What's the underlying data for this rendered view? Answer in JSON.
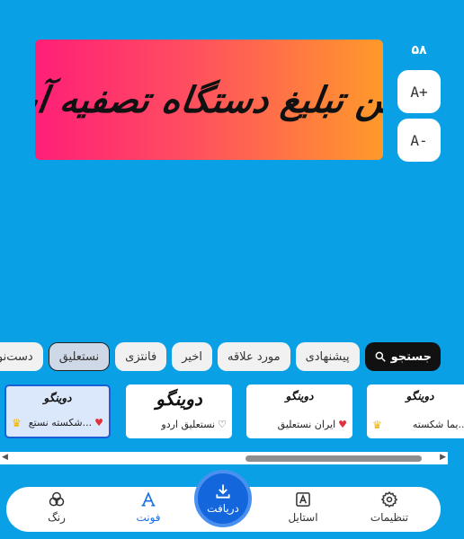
{
  "banner": {
    "text": "متن تبلیغ دستگاه تصفیه آب"
  },
  "size": {
    "value": "۵۸",
    "increase_label": "A+",
    "decrease_label": "A-"
  },
  "chips": [
    {
      "label": "جستجو",
      "icon": "search-icon"
    },
    {
      "label": "پیشنهادی"
    },
    {
      "label": "مورد علاقه"
    },
    {
      "label": "اخیر"
    },
    {
      "label": "فانتزی"
    },
    {
      "label": "نستعلیق",
      "active": true
    },
    {
      "label": "دست‌نویس"
    }
  ],
  "fonts": [
    {
      "preview": "دوینگو",
      "name": "...یما شکسته",
      "badge": "crown-icon"
    },
    {
      "preview": "دوینگو",
      "name": "ایران نستعلیق",
      "favorite": true
    },
    {
      "preview": "دوینگو",
      "name": "نستعلیق اردو",
      "favorite": false
    },
    {
      "preview": "دوینگو",
      "name": "...شکسته نستع",
      "favorite": true,
      "badge": "crown-icon",
      "selected": true
    }
  ],
  "nav": {
    "settings": "تنظیمات",
    "style": "استایل",
    "download": "دریافت",
    "font": "فونت",
    "color": "رنگ"
  }
}
